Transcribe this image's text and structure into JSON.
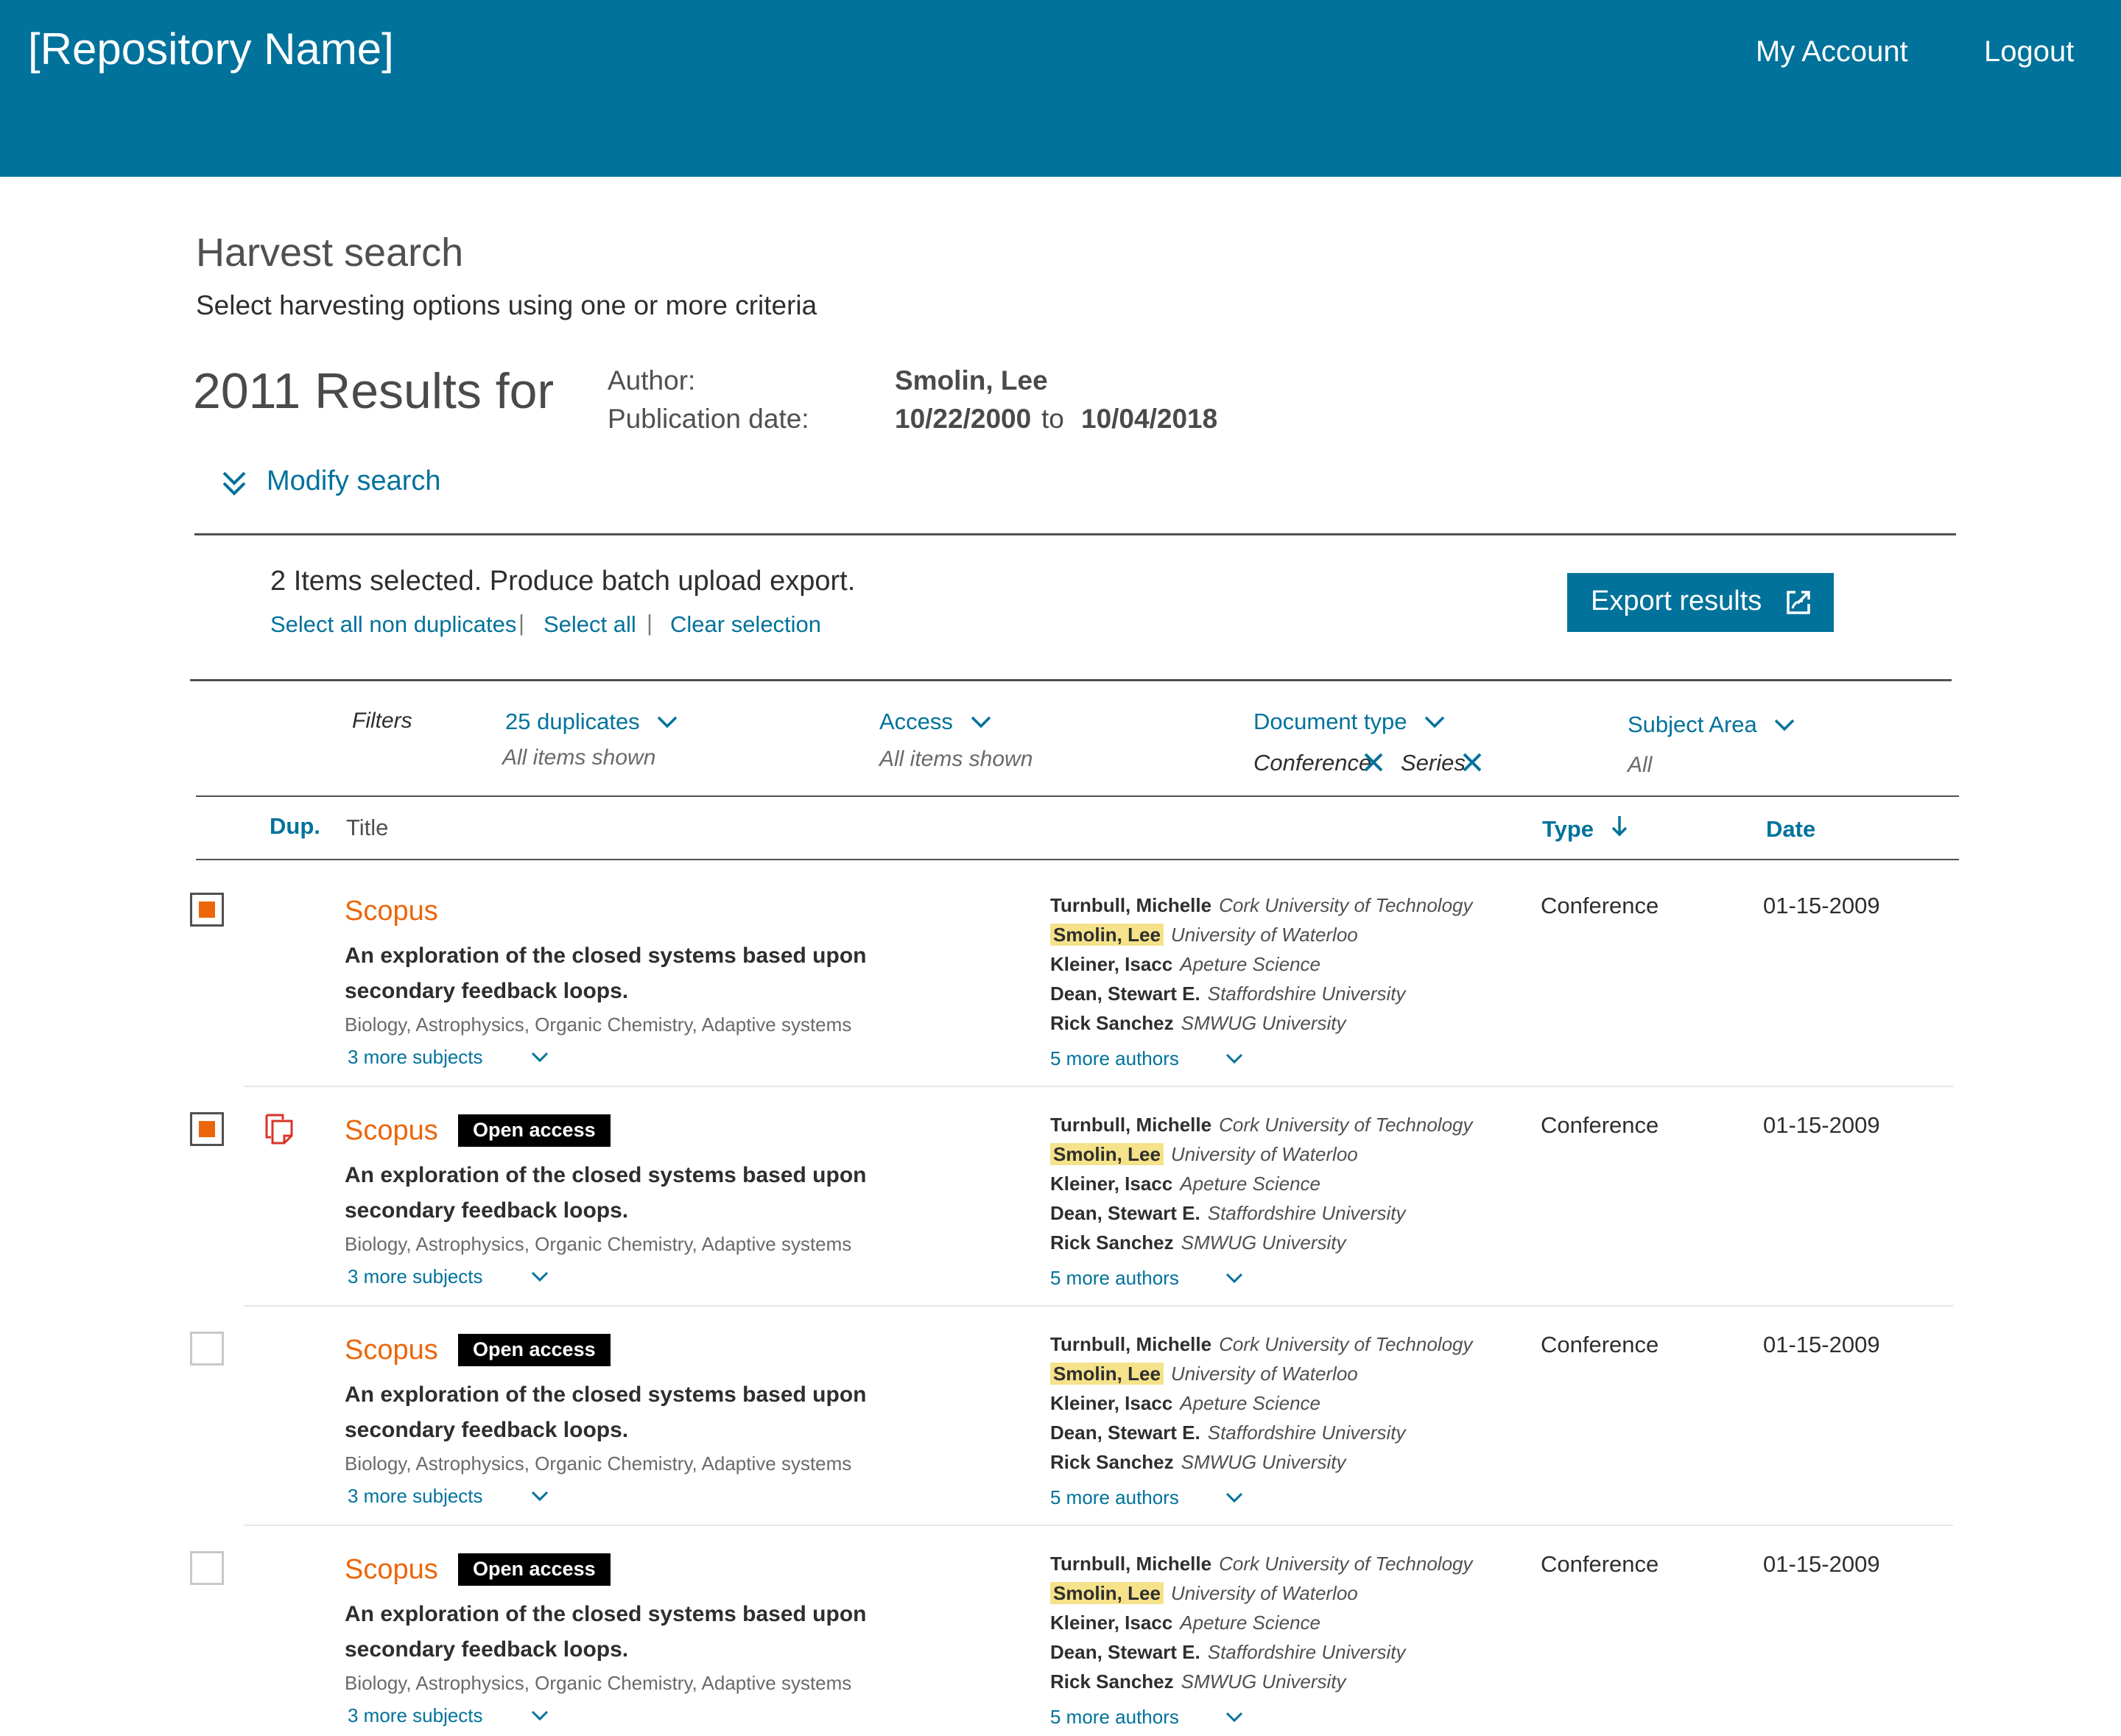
{
  "header": {
    "brand": "[Repository Name]",
    "my_account": "My Account",
    "logout": "Logout",
    "bg_color": "#00729b"
  },
  "search": {
    "title": "Harvest search",
    "subtitle": "Select harvesting options using one or more criteria",
    "results_count": "2011 Results for",
    "author_label": "Author:",
    "author_value": "Smolin, Lee",
    "date_label": "Publication date:",
    "date_from": "10/22/2000",
    "date_to_word": "to",
    "date_to": "10/04/2018",
    "modify_label": "Modify search",
    "modify_icon": "double-chevron-down-icon"
  },
  "selection": {
    "message": "2 Items selected. Produce batch upload export.",
    "select_non_duplicates": "Select all non duplicates",
    "select_all": "Select all",
    "clear_selection": "Clear selection",
    "separator": "|",
    "export_label": "Export results",
    "export_icon": "export-icon"
  },
  "filters": {
    "label": "Filters",
    "duplicates": {
      "label": "25 duplicates",
      "sub": "All items shown"
    },
    "access": {
      "label": "Access",
      "sub": "All items shown"
    },
    "document_type": {
      "label": "Document type",
      "chips": [
        "Conference",
        "Series"
      ]
    },
    "subject_area": {
      "label": "Subject Area",
      "sub": "All"
    }
  },
  "table": {
    "col_dup": "Dup.",
    "col_title": "Title",
    "col_type": "Type",
    "col_date": "Date"
  },
  "rows": [
    {
      "checked": true,
      "duplicate": false,
      "source": "Scopus",
      "badge": "",
      "title": "An exploration of the closed systems based upon secondary feedback loops.",
      "subjects": "Biology, Astrophysics, Organic Chemistry, Adaptive systems",
      "more_subjects": "3 more subjects",
      "authors": [
        {
          "name": "Turnbull, Michelle",
          "aff": "Cork University of Technology",
          "highlight": false
        },
        {
          "name": "Smolin, Lee",
          "aff": "University of Waterloo",
          "highlight": true
        },
        {
          "name": "Kleiner, Isacc",
          "aff": "Apeture Science",
          "highlight": false
        },
        {
          "name": "Dean, Stewart E.",
          "aff": "Staffordshire University",
          "highlight": false
        },
        {
          "name": "Rick Sanchez",
          "aff": "SMWUG University",
          "highlight": false
        }
      ],
      "more_authors": "5 more authors",
      "type": "Conference",
      "date": "01-15-2009"
    },
    {
      "checked": true,
      "duplicate": true,
      "source": "Scopus",
      "badge": "Open access",
      "title": "An exploration of the closed systems based upon secondary feedback loops.",
      "subjects": "Biology, Astrophysics, Organic Chemistry, Adaptive systems",
      "more_subjects": "3 more subjects",
      "authors": [
        {
          "name": "Turnbull, Michelle",
          "aff": "Cork University of Technology",
          "highlight": false
        },
        {
          "name": "Smolin, Lee",
          "aff": "University of Waterloo",
          "highlight": true
        },
        {
          "name": "Kleiner, Isacc",
          "aff": "Apeture Science",
          "highlight": false
        },
        {
          "name": "Dean, Stewart E.",
          "aff": "Staffordshire University",
          "highlight": false
        },
        {
          "name": "Rick Sanchez",
          "aff": "SMWUG University",
          "highlight": false
        }
      ],
      "more_authors": "5 more authors",
      "type": "Conference",
      "date": "01-15-2009"
    },
    {
      "checked": false,
      "duplicate": false,
      "source": "Scopus",
      "badge": "Open access",
      "title": "An exploration of the closed systems based upon secondary feedback loops.",
      "subjects": "Biology, Astrophysics, Organic Chemistry, Adaptive systems",
      "more_subjects": "3 more subjects",
      "authors": [
        {
          "name": "Turnbull, Michelle",
          "aff": "Cork University of Technology",
          "highlight": false
        },
        {
          "name": "Smolin, Lee",
          "aff": "University of Waterloo",
          "highlight": true
        },
        {
          "name": "Kleiner, Isacc",
          "aff": "Apeture Science",
          "highlight": false
        },
        {
          "name": "Dean, Stewart E.",
          "aff": "Staffordshire University",
          "highlight": false
        },
        {
          "name": "Rick Sanchez",
          "aff": "SMWUG University",
          "highlight": false
        }
      ],
      "more_authors": "5 more authors",
      "type": "Conference",
      "date": "01-15-2009"
    },
    {
      "checked": false,
      "duplicate": false,
      "source": "Scopus",
      "badge": "Open access",
      "title": "An exploration of the closed systems based upon secondary feedback loops.",
      "subjects": "Biology, Astrophysics, Organic Chemistry, Adaptive systems",
      "more_subjects": "3 more subjects",
      "authors": [
        {
          "name": "Turnbull, Michelle",
          "aff": "Cork University of Technology",
          "highlight": false
        },
        {
          "name": "Smolin, Lee",
          "aff": "University of Waterloo",
          "highlight": true
        },
        {
          "name": "Kleiner, Isacc",
          "aff": "Apeture Science",
          "highlight": false
        },
        {
          "name": "Dean, Stewart E.",
          "aff": "Staffordshire University",
          "highlight": false
        },
        {
          "name": "Rick Sanchez",
          "aff": "SMWUG University",
          "highlight": false
        }
      ],
      "more_authors": "5 more authors",
      "type": "Conference",
      "date": "01-15-2009"
    }
  ]
}
